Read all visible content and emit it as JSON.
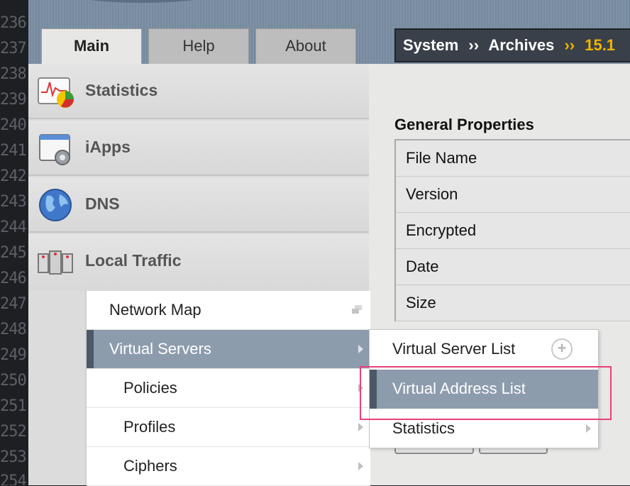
{
  "line_numbers": [
    "236",
    "237",
    "238",
    "239",
    "240",
    "241",
    "242",
    "243",
    "244",
    "245",
    "246",
    "247",
    "248",
    "249",
    "250",
    "251",
    "252",
    "253",
    "254"
  ],
  "tabs": [
    {
      "label": "Main",
      "active": true
    },
    {
      "label": "Help",
      "active": false
    },
    {
      "label": "About",
      "active": false
    }
  ],
  "breadcrumb": {
    "items": [
      "System",
      "Archives",
      "15.1"
    ],
    "separator": "››"
  },
  "nav": {
    "items": [
      {
        "label": "Statistics",
        "icon": "statistics-icon"
      },
      {
        "label": "iApps",
        "icon": "iapps-icon"
      },
      {
        "label": "DNS",
        "icon": "globe-icon"
      },
      {
        "label": "Local Traffic",
        "icon": "local-traffic-icon"
      }
    ]
  },
  "submenu": {
    "items": [
      {
        "label": "Network Map",
        "selected": false
      },
      {
        "label": "Virtual Servers",
        "selected": true
      },
      {
        "label": "Policies",
        "selected": false
      },
      {
        "label": "Profiles",
        "selected": false
      },
      {
        "label": "Ciphers",
        "selected": false
      }
    ]
  },
  "flyout": {
    "items": [
      {
        "label": "Virtual Server List",
        "selected": false
      },
      {
        "label": "Virtual Address List",
        "selected": true
      },
      {
        "label": "Statistics",
        "selected": false
      }
    ]
  },
  "general_properties": {
    "title": "General Properties",
    "rows": [
      "File Name",
      "Version",
      "Encrypted",
      "Date",
      "Size"
    ]
  },
  "colors": {
    "selected": "#8d9cad",
    "highlight": "#e8407a",
    "breadcrumb_accent": "#f0b400"
  }
}
